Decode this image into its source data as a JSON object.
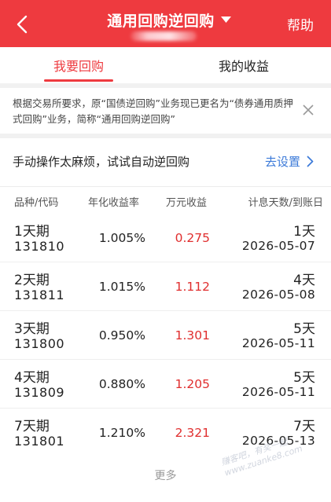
{
  "header": {
    "title": "通用回购逆回购",
    "help_label": "帮助"
  },
  "tabs": [
    {
      "label": "我要回购",
      "active": true
    },
    {
      "label": "我的收益",
      "active": false
    }
  ],
  "notice": {
    "text": "根据交易所要求，原“国债逆回购”业务现已更名为“债券通用质押式回购”业务，简称“通用回购逆回购”"
  },
  "auto": {
    "text": "手动操作太麻烦，试试自动逆回购",
    "link_label": "去设置"
  },
  "table": {
    "headers": [
      "品种/代码",
      "年化收益率",
      "万元收益",
      "计息天数/到账日"
    ],
    "rows": [
      {
        "name": "1天期",
        "code": "131810",
        "rate": "1.005%",
        "profit": "0.275",
        "days": "1天",
        "date": "2026-05-07"
      },
      {
        "name": "2天期",
        "code": "131811",
        "rate": "1.015%",
        "profit": "1.112",
        "days": "4天",
        "date": "2026-05-08"
      },
      {
        "name": "3天期",
        "code": "131800",
        "rate": "0.950%",
        "profit": "1.301",
        "days": "5天",
        "date": "2026-05-11"
      },
      {
        "name": "4天期",
        "code": "131809",
        "rate": "0.880%",
        "profit": "1.205",
        "days": "5天",
        "date": "2026-05-11"
      },
      {
        "name": "7天期",
        "code": "131801",
        "rate": "1.210%",
        "profit": "2.321",
        "days": "7天",
        "date": "2026-05-13"
      }
    ],
    "more_label": "更多"
  },
  "watermark": {
    "line1": "赚客吧，有奖一起",
    "line2": "www.zuanke8.com"
  },
  "colors": {
    "brand_red": "#ee3a3f",
    "link_blue": "#3d7bd9",
    "profit_red": "#e02e2e"
  },
  "icons": {
    "back": "chevron-left-icon",
    "dropdown": "caret-down-icon",
    "close": "close-icon",
    "link": "chevron-right-icon"
  }
}
